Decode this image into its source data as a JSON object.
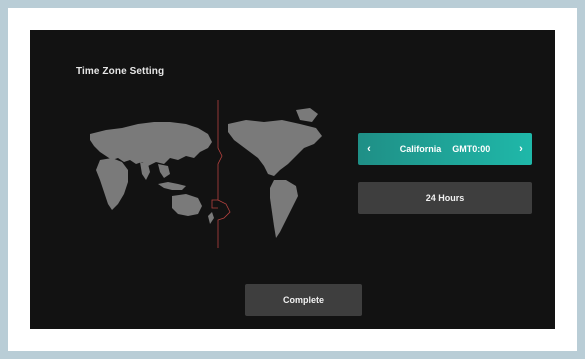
{
  "screen": {
    "title": "Time Zone Setting"
  },
  "timezone": {
    "region": "California",
    "offset": "GMT0:00",
    "prev_icon": "chevron-left-icon",
    "next_icon": "chevron-right-icon"
  },
  "format_button": {
    "label": "24 Hours"
  },
  "complete_button": {
    "label": "Complete"
  },
  "colors": {
    "background": "#121212",
    "accent_start": "#1f8f86",
    "accent_end": "#1fb8a9",
    "button": "#3e3e3e",
    "map_land": "#7a7a7a",
    "boundary_line": "#b5423f"
  }
}
